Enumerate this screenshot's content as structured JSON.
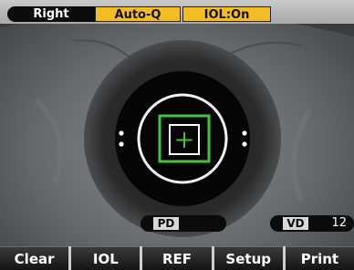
{
  "top_bar": {
    "eye_side": "Right",
    "mode": "Auto-Q",
    "iol_status": "IOL:On"
  },
  "readings": {
    "pd_label": "PD",
    "pd_value": "",
    "vd_label": "VD",
    "vd_value": "12"
  },
  "softkeys": [
    "Clear",
    "IOL",
    "REF",
    "Setup",
    "Print"
  ],
  "colors": {
    "alignment_green": "#46c23a",
    "status_yellow": "#f2bc25",
    "softkey_black": "#141414"
  },
  "icons": [
    "alignment-target-icon",
    "alignment-ring-icon",
    "crosshair-icon"
  ]
}
